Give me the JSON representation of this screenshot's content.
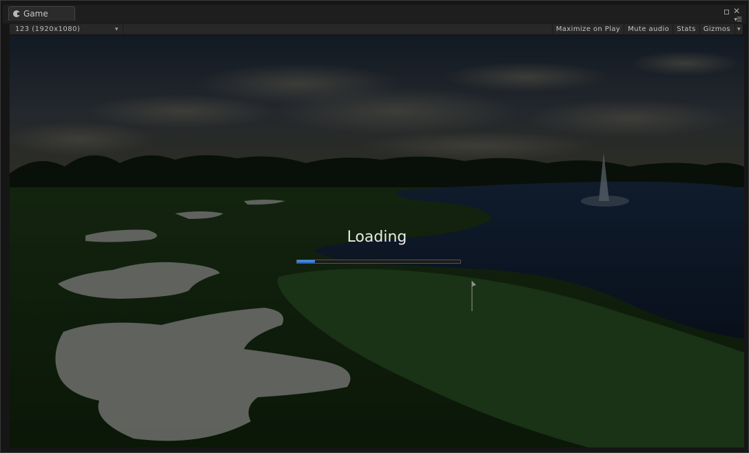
{
  "window": {
    "tab_label": "Game",
    "tab_icon": "pacman-icon"
  },
  "toolbar": {
    "resolution": "123 (1920x1080)",
    "maximize_on_play": "Maximize on Play",
    "mute_audio": "Mute audio",
    "stats": "Stats",
    "gizmos": "Gizmos"
  },
  "game": {
    "loading_text": "Loading",
    "progress": 0.11,
    "progress_color": "#2f7de0"
  }
}
